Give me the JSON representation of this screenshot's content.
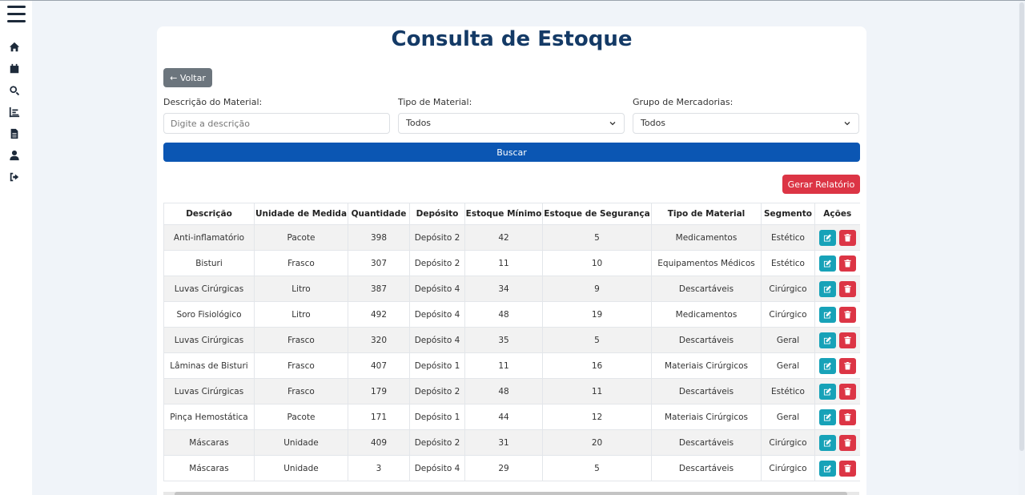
{
  "page": {
    "title": "Consulta de Estoque"
  },
  "sidebar": {
    "items": [
      {
        "icon": "home-icon"
      },
      {
        "icon": "calendar-icon"
      },
      {
        "icon": "search-icon"
      },
      {
        "icon": "bar-chart-icon"
      },
      {
        "icon": "document-icon"
      },
      {
        "icon": "user-icon"
      },
      {
        "icon": "logout-icon"
      }
    ]
  },
  "back_button": {
    "label": "← Voltar"
  },
  "filters": {
    "descricao": {
      "label": "Descrição do Material:",
      "placeholder": "Digite a descrição",
      "value": ""
    },
    "tipo": {
      "label": "Tipo de Material:",
      "value": "Todos"
    },
    "grupo": {
      "label": "Grupo de Mercadorias:",
      "value": "Todos"
    }
  },
  "search_button": {
    "label": "Buscar"
  },
  "report_button": {
    "label": "Gerar Relatório"
  },
  "colors": {
    "primary": "#0b56b3",
    "danger": "#dc3545",
    "info": "#17a2b8",
    "secondary": "#6c757d",
    "title": "#143a66"
  },
  "table": {
    "headers": [
      "Descrição",
      "Unidade de Medida",
      "Quantidade",
      "Depósito",
      "Estoque Mínimo",
      "Estoque de Segurança",
      "Tipo de Material",
      "Segmento",
      "Ações"
    ],
    "rows": [
      [
        "Anti-inflamatório",
        "Pacote",
        "398",
        "Depósito 2",
        "42",
        "5",
        "Medicamentos",
        "Estético"
      ],
      [
        "Bisturi",
        "Frasco",
        "307",
        "Depósito 2",
        "11",
        "10",
        "Equipamentos Médicos",
        "Estético"
      ],
      [
        "Luvas Cirúrgicas",
        "Litro",
        "387",
        "Depósito 4",
        "34",
        "9",
        "Descartáveis",
        "Cirúrgico"
      ],
      [
        "Soro Fisiológico",
        "Litro",
        "492",
        "Depósito 4",
        "48",
        "19",
        "Medicamentos",
        "Cirúrgico"
      ],
      [
        "Luvas Cirúrgicas",
        "Frasco",
        "320",
        "Depósito 4",
        "35",
        "5",
        "Descartáveis",
        "Geral"
      ],
      [
        "Lâminas de Bisturi",
        "Frasco",
        "407",
        "Depósito 1",
        "11",
        "16",
        "Materiais Cirúrgicos",
        "Geral"
      ],
      [
        "Luvas Cirúrgicas",
        "Frasco",
        "179",
        "Depósito 2",
        "48",
        "11",
        "Descartáveis",
        "Estético"
      ],
      [
        "Pinça Hemostática",
        "Pacote",
        "171",
        "Depósito 1",
        "44",
        "12",
        "Materiais Cirúrgicos",
        "Geral"
      ],
      [
        "Máscaras",
        "Unidade",
        "409",
        "Depósito 2",
        "31",
        "20",
        "Descartáveis",
        "Cirúrgico"
      ],
      [
        "Máscaras",
        "Unidade",
        "3",
        "Depósito 4",
        "29",
        "5",
        "Descartáveis",
        "Cirúrgico"
      ]
    ],
    "row_actions": [
      {
        "icon": "edit-icon"
      },
      {
        "icon": "trash-icon"
      }
    ]
  }
}
